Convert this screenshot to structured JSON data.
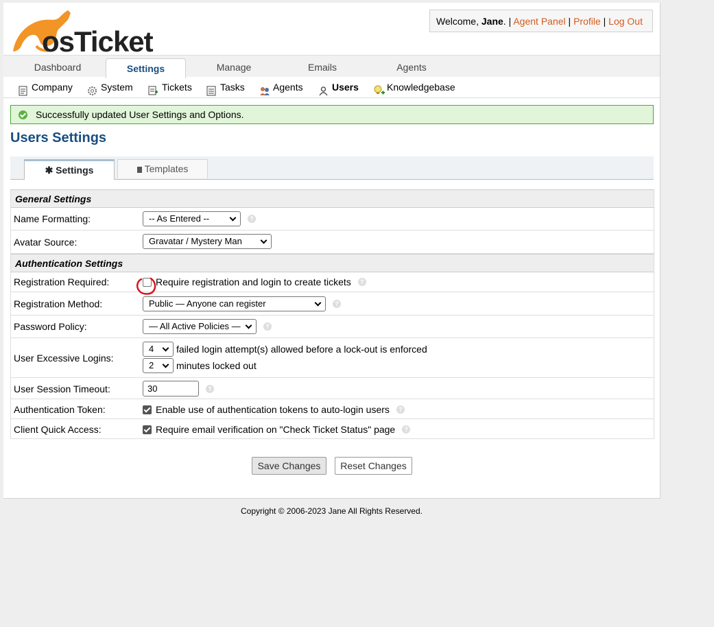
{
  "header": {
    "logo_text": "osTicket",
    "welcome_prefix": "Welcome,",
    "user_name": "Jane",
    "welcome_suffix": ".",
    "sep": "|",
    "links": [
      "Agent Panel",
      "Profile",
      "Log Out"
    ],
    "link_color": "#d25b1f"
  },
  "nav": {
    "tabs": [
      {
        "label": "Dashboard",
        "active": false
      },
      {
        "label": "Settings",
        "active": true
      },
      {
        "label": "Manage",
        "active": false
      },
      {
        "label": "Emails",
        "active": false
      },
      {
        "label": "Agents",
        "active": false
      }
    ]
  },
  "subnav": {
    "items": [
      {
        "label": "Company",
        "icon": "company-icon"
      },
      {
        "label": "System",
        "icon": "gear-icon"
      },
      {
        "label": "Tickets",
        "icon": "ticket-icon"
      },
      {
        "label": "Tasks",
        "icon": "tasks-icon"
      },
      {
        "label": "Agents",
        "icon": "agents-icon"
      },
      {
        "label": "Users",
        "icon": "users-icon",
        "active": true
      },
      {
        "label": "Knowledgebase",
        "icon": "knowledgebase-icon"
      }
    ]
  },
  "message": "Successfully updated User Settings and Options.",
  "page_title": "Users Settings",
  "page_tabs": {
    "settings": "✱ Settings",
    "templates": "Templates"
  },
  "sections": {
    "general": "General Settings",
    "auth": "Authentication Settings"
  },
  "fields": {
    "name_formatting": {
      "label": "Name Formatting:",
      "value": "-- As Entered --"
    },
    "avatar_source": {
      "label": "Avatar Source:",
      "value": "Gravatar / Mystery Man"
    },
    "registration_required": {
      "label": "Registration Required:",
      "text": "Require registration and login to create tickets",
      "checked": false
    },
    "registration_method": {
      "label": "Registration Method:",
      "value": "Public — Anyone can register"
    },
    "password_policy": {
      "label": "Password Policy:",
      "value": "— All Active Policies —"
    },
    "excessive_logins": {
      "label": "User Excessive Logins:",
      "attempts": "4",
      "attempts_text": "failed login attempt(s) allowed before a lock-out is enforced",
      "minutes": "2",
      "minutes_text": "minutes locked out"
    },
    "session_timeout": {
      "label": "User Session Timeout:",
      "value": "30"
    },
    "auth_token": {
      "label": "Authentication Token:",
      "text": "Enable use of authentication tokens to auto-login users",
      "checked": true
    },
    "client_quick_access": {
      "label": "Client Quick Access:",
      "text": "Require email verification on \"Check Ticket Status\" page",
      "checked": true
    }
  },
  "buttons": {
    "save": "Save Changes",
    "reset": "Reset Changes"
  },
  "footer": "Copyright © 2006-2023 Jane All Rights Reserved.",
  "colors": {
    "title": "#184e81",
    "success_bg": "#e1f5d9",
    "success_border": "#47a935",
    "annotation": "#d9141c"
  }
}
